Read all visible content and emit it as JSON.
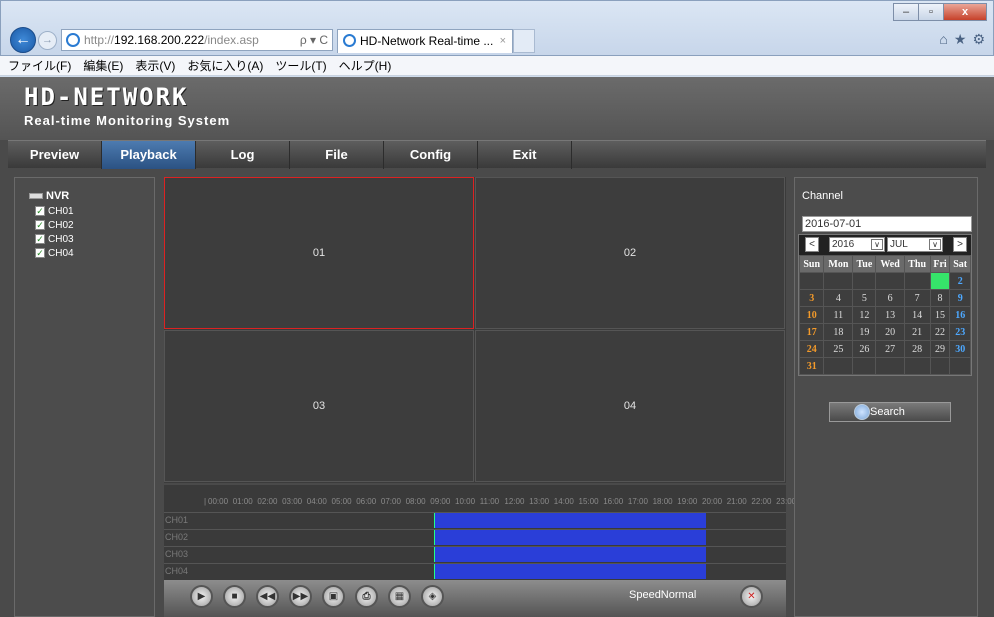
{
  "browser": {
    "address_prefix": "http://",
    "address_host": "192.168.200.222",
    "address_path": "/index.asp",
    "address_controls": "ρ ▾ C",
    "tab_title": "HD-Network Real-time ...",
    "tab_close": "×",
    "menu": [
      "ファイル(F)",
      "編集(E)",
      "表示(V)",
      "お気に入り(A)",
      "ツール(T)",
      "ヘルプ(H)"
    ],
    "window_buttons": {
      "minimize": "–",
      "restore": "▫",
      "close": "x"
    },
    "tool_icons": [
      "home-icon",
      "star-icon",
      "gear-icon"
    ]
  },
  "app": {
    "brand": "HD-NETWORK",
    "subtitle": "Real-time Monitoring System",
    "nav": [
      "Preview",
      "Playback",
      "Log",
      "File",
      "Config",
      "Exit"
    ],
    "active_nav": "Playback"
  },
  "tree": {
    "root": "NVR",
    "channels": [
      "CH01",
      "CH02",
      "CH03",
      "CH04"
    ]
  },
  "video": {
    "cells": [
      "01",
      "02",
      "03",
      "04"
    ],
    "selected": "01"
  },
  "timeline": {
    "ruler_prefix": "|",
    "hours": [
      "00:00",
      "01:00",
      "02:00",
      "03:00",
      "04:00",
      "05:00",
      "06:00",
      "07:00",
      "08:00",
      "09:00",
      "10:00",
      "11:00",
      "12:00",
      "13:00",
      "14:00",
      "15:00",
      "16:00",
      "17:00",
      "18:00",
      "19:00",
      "20:00",
      "21:00",
      "22:00",
      "23:00"
    ],
    "rows": [
      "CH01",
      "CH02",
      "CH03",
      "CH04"
    ],
    "recording_start_hour": 9,
    "recording_end_hour": 20,
    "recording_color": "#2a3ed8"
  },
  "controls": {
    "buttons": [
      "play-icon",
      "stop-icon",
      "rewind-icon",
      "fast-forward-icon",
      "snapshot-icon",
      "print-icon",
      "download-icon",
      "fullscreen-icon"
    ],
    "speed_label": "SpeedNormal",
    "mute_icon": "mute-icon"
  },
  "calendar": {
    "channel_label": "Channel",
    "date_value": "2016-07-01",
    "prev": "<",
    "next": ">",
    "year": "2016",
    "month": "JUL",
    "weekdays": [
      "Sun",
      "Mon",
      "Tue",
      "Wed",
      "Thu",
      "Fri",
      "Sat"
    ],
    "weeks": [
      [
        "",
        "",
        "",
        "",
        "",
        "1",
        "2"
      ],
      [
        "3",
        "4",
        "5",
        "6",
        "7",
        "8",
        "9"
      ],
      [
        "10",
        "11",
        "12",
        "13",
        "14",
        "15",
        "16"
      ],
      [
        "17",
        "18",
        "19",
        "20",
        "21",
        "22",
        "23"
      ],
      [
        "24",
        "25",
        "26",
        "27",
        "28",
        "29",
        "30"
      ],
      [
        "31",
        "",
        "",
        "",
        "",
        "",
        ""
      ]
    ],
    "highlight_day": "1",
    "search_label": "Search"
  }
}
